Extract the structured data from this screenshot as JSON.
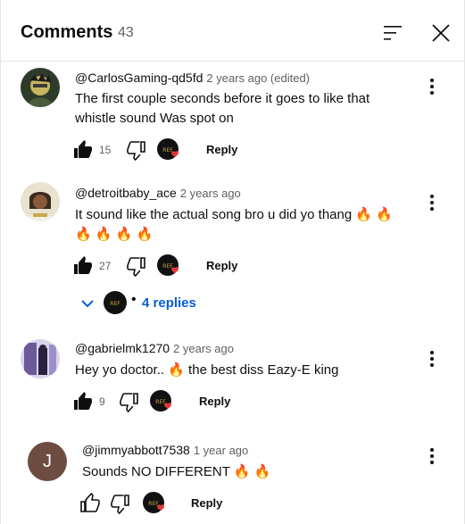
{
  "header": {
    "title": "Comments",
    "count": "43"
  },
  "comments": [
    {
      "author": "@CarlosGaming-qd5fd",
      "time": "2 years ago (edited)",
      "text": "The first couple seconds before it goes to like that whistle sound Was spot on",
      "likes": "15",
      "reply_label": "Reply"
    },
    {
      "author": "@detroitbaby_ace",
      "time": "2 years ago",
      "text": "It sound like the actual song bro u did yo thang 🔥 🔥 🔥 🔥 🔥 🔥",
      "likes": "27",
      "reply_label": "Reply",
      "replies_label": "4 replies"
    },
    {
      "author": "@gabrielmk1270",
      "time": "2 years ago",
      "text": "Hey yo doctor..  🔥  the best diss Eazy-E king",
      "likes": "9",
      "reply_label": "Reply"
    },
    {
      "author": "@jimmyabbott7538",
      "time": "1 year ago",
      "text": "Sounds NO DIFFERENT   🔥  🔥",
      "likes": "",
      "reply_label": "Reply",
      "avatar_letter": "J"
    }
  ],
  "colors": {
    "link": "#065fd4",
    "avatar_j": "#6d4c41",
    "heart": "#e53935"
  },
  "icons": [
    "sort-icon",
    "close-icon",
    "thumbs-up-icon",
    "thumbs-down-icon",
    "creator-heart-icon",
    "more-vert-icon",
    "chevron-down-icon"
  ]
}
